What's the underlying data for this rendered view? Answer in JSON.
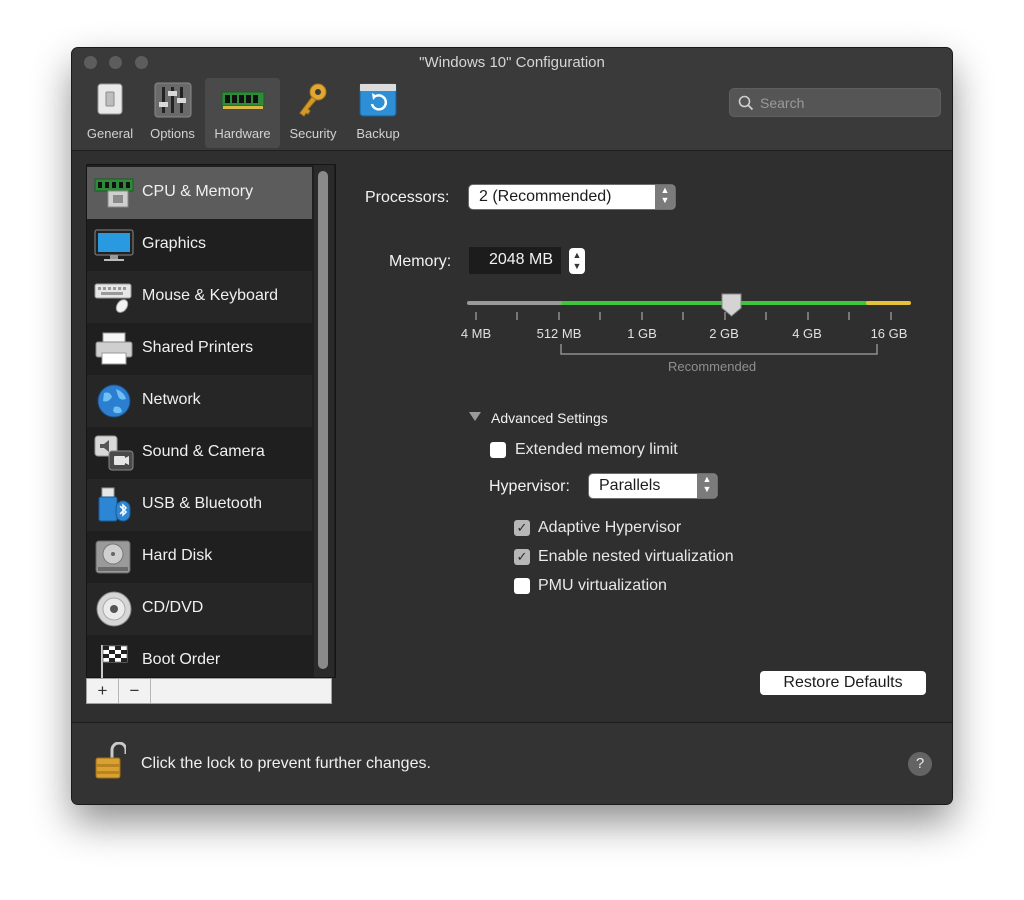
{
  "window": {
    "title": "\"Windows 10\" Configuration"
  },
  "toolbar": {
    "items": [
      {
        "label": "General",
        "icon": "general-switch-icon"
      },
      {
        "label": "Options",
        "icon": "options-sliders-icon"
      },
      {
        "label": "Hardware",
        "icon": "hardware-memory-chip-icon",
        "selected": true
      },
      {
        "label": "Security",
        "icon": "security-key-icon"
      },
      {
        "label": "Backup",
        "icon": "backup-restore-icon"
      }
    ],
    "search_placeholder": "Search"
  },
  "sidebar": {
    "items": [
      {
        "label": "CPU & Memory",
        "icon": "cpu-memory-icon",
        "selected": true
      },
      {
        "label": "Graphics",
        "icon": "monitor-icon"
      },
      {
        "label": "Mouse & Keyboard",
        "icon": "keyboard-mouse-icon"
      },
      {
        "label": "Shared Printers",
        "icon": "printer-icon"
      },
      {
        "label": "Network",
        "icon": "globe-icon"
      },
      {
        "label": "Sound & Camera",
        "icon": "speaker-camera-icon"
      },
      {
        "label": "USB & Bluetooth",
        "icon": "usb-bluetooth-icon"
      },
      {
        "label": "Hard Disk",
        "icon": "hard-disk-icon"
      },
      {
        "label": "CD/DVD",
        "icon": "cd-dvd-icon"
      },
      {
        "label": "Boot Order",
        "icon": "checkered-flag-icon"
      }
    ],
    "add_label": "+",
    "remove_label": "−"
  },
  "cpu": {
    "processors_label": "Processors:",
    "processors_value": "2 (Recommended)",
    "memory_label": "Memory:",
    "memory_value": "2048 MB",
    "slider": {
      "ticks": [
        "4 MB",
        "512 MB",
        "1 GB",
        "2 GB",
        "4 GB",
        "16 GB"
      ],
      "value": "2 GB",
      "recommended_label": "Recommended",
      "colors": {
        "low": "#9a9a9a",
        "recommended": "#3ec73e",
        "high": "#e6c23a"
      }
    }
  },
  "advanced": {
    "label": "Advanced Settings",
    "extended_memory": {
      "label": "Extended memory limit",
      "checked": false
    },
    "hypervisor_label": "Hypervisor:",
    "hypervisor_value": "Parallels",
    "adaptive": {
      "label": "Adaptive Hypervisor",
      "checked": true
    },
    "nested": {
      "label": "Enable nested virtualization",
      "checked": true
    },
    "pmu": {
      "label": "PMU virtualization",
      "checked": false
    }
  },
  "restore_label": "Restore Defaults",
  "footer": {
    "lock_message": "Click the lock to prevent further changes.",
    "help_label": "?"
  }
}
